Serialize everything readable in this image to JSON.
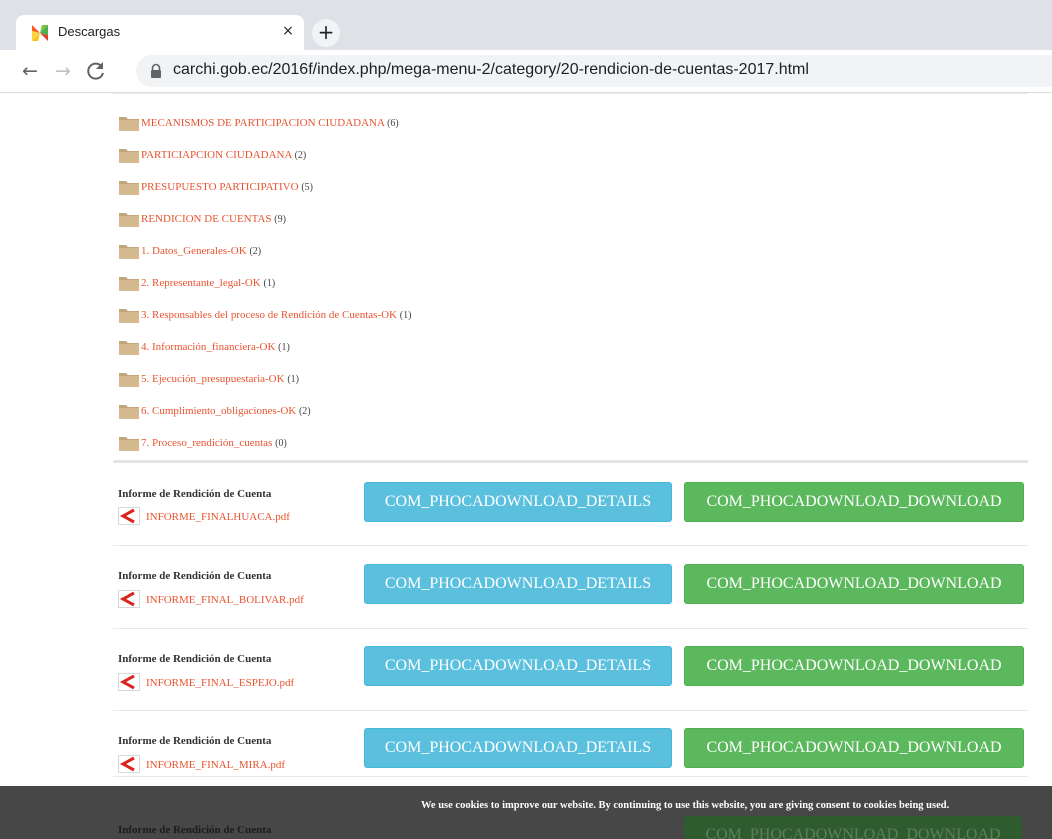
{
  "browser": {
    "tab_title": "Descargas",
    "tab_close": "×",
    "new_tab": "+",
    "url": "carchi.gob.ec/2016f/index.php/mega-menu-2/category/20-rendicion-de-cuentas-2017.html",
    "back": "←",
    "forward": "→",
    "reload": "C"
  },
  "categories": [
    {
      "label": "MECANISMOS DE PARTICIPACION CIUDADANA",
      "count": "(6)"
    },
    {
      "label": "PARTICIAPCION CIUDADANA",
      "count": "(2)"
    },
    {
      "label": "PRESUPUESTO PARTICIPATIVO",
      "count": "(5)"
    },
    {
      "label": "RENDICION DE CUENTAS",
      "count": "(9)"
    },
    {
      "label": "1. Datos_Generales-OK",
      "count": "(2)"
    },
    {
      "label": "2. Representante_legal-OK",
      "count": "(1)"
    },
    {
      "label": "3. Responsables del proceso de Rendición de Cuentas-OK",
      "count": "(1)"
    },
    {
      "label": "4. Información_financiera-OK",
      "count": "(1)"
    },
    {
      "label": "5. Ejecución_presupuestaria-OK",
      "count": "(1)"
    },
    {
      "label": "6. Cumplimiento_obligaciones-OK",
      "count": "(2)"
    },
    {
      "label": "7. Proceso_rendición_cuentas",
      "count": "(0)"
    }
  ],
  "files": [
    {
      "title": "Informe de Rendición de Cuenta",
      "filename": "INFORME_FINALHUACA.pdf",
      "details_label": "COM_PHOCADOWNLOAD_DETAILS",
      "download_label": "COM_PHOCADOWNLOAD_DOWNLOAD"
    },
    {
      "title": "Informe de Rendición de Cuenta",
      "filename": "INFORME_FINAL_BOLIVAR.pdf",
      "details_label": "COM_PHOCADOWNLOAD_DETAILS",
      "download_label": "COM_PHOCADOWNLOAD_DOWNLOAD"
    },
    {
      "title": "Informe de Rendición de Cuenta",
      "filename": "INFORME_FINAL_ESPEJO.pdf",
      "details_label": "COM_PHOCADOWNLOAD_DETAILS",
      "download_label": "COM_PHOCADOWNLOAD_DOWNLOAD"
    },
    {
      "title": "Informe de Rendición de Cuenta",
      "filename": "INFORME_FINAL_MIRA.pdf",
      "details_label": "COM_PHOCADOWNLOAD_DETAILS",
      "download_label": "COM_PHOCADOWNLOAD_DOWNLOAD"
    }
  ],
  "partial_file": {
    "title": "Informe de Rendición de Cuenta",
    "download_label": "COM_PHOCADOWNLOAD_DOWNLOAD"
  },
  "cookie_notice": "We use cookies to improve our website. By continuing to use this website, you are giving consent to cookies being used."
}
